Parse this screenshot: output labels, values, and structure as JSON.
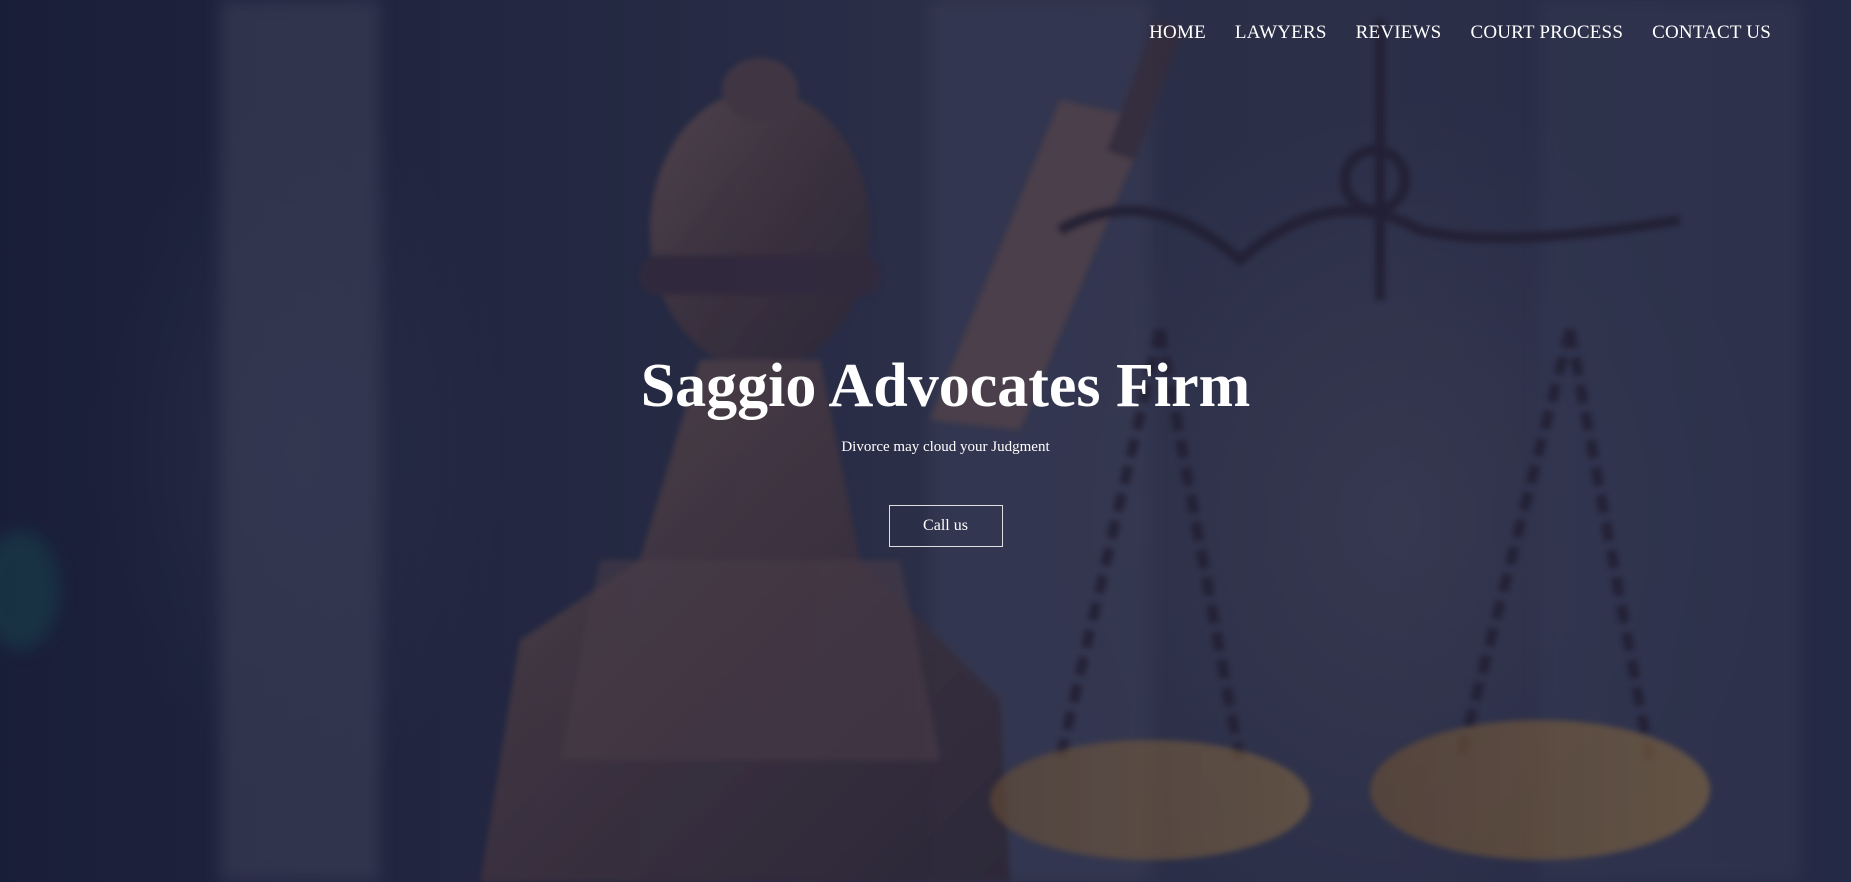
{
  "nav": {
    "items": [
      {
        "label": "HOME"
      },
      {
        "label": "LAWYERS"
      },
      {
        "label": "REVIEWS"
      },
      {
        "label": "COURT PROCESS"
      },
      {
        "label": "CONTACT US"
      }
    ]
  },
  "hero": {
    "title": "Saggio Advocates Firm",
    "subtitle": "Divorce may cloud your Judgment",
    "cta_label": "Call us",
    "background_image": "lady-justice-statue-with-scales"
  },
  "colors": {
    "overlay": "#191c37",
    "text": "#ffffff"
  }
}
